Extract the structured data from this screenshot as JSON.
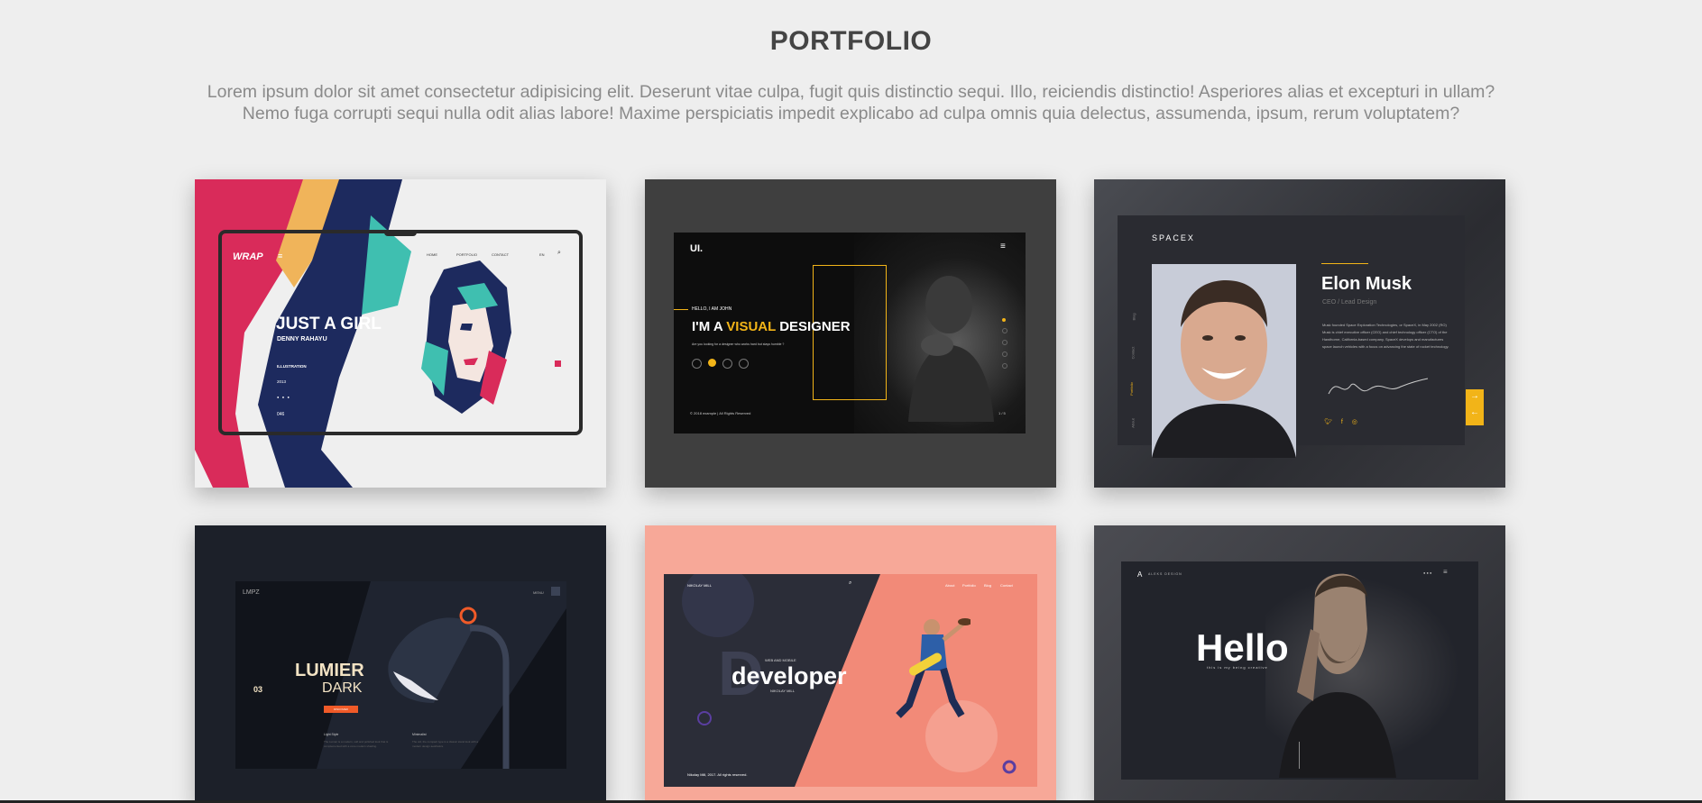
{
  "section": {
    "title": "PORTFOLIO",
    "intro_line1": "Lorem ipsum dolor sit amet consectetur adipisicing elit. Deserunt vitae culpa, fugit quis distinctio sequi. Illo, reiciendis distinctio! Asperiores alias et excepturi in ullam?",
    "intro_line2": "Nemo fuga corrupti sequi nulla odit alias labore! Maxime perspiciatis impedit explicabo ad culpa omnis quia delectus, assumenda, ipsum, rerum voluptatem?"
  },
  "colors": {
    "page_bg": "#eeeeee",
    "title": "#444444",
    "intro_text": "#8a8a8a",
    "accent_yellow": "#f2b418",
    "accent_pink": "#d92b5a",
    "accent_orange": "#f05a28",
    "accent_salmon": "#f7a898"
  },
  "portfolio": [
    {
      "id": "girl",
      "nav": [
        "HOME",
        "PORTFOLIO",
        "CONTACT",
        "EN"
      ],
      "headline": "JUST A GIRL",
      "subtitle": "DENNY RAHAYU",
      "category": "ILLUSTRATION",
      "year": "2013",
      "count": "046"
    },
    {
      "id": "visual-designer",
      "logo": "UI.",
      "kicker": "HELLO, I AM JOHN",
      "headline_pre": "I'M A ",
      "headline_accent": "VISUAL",
      "headline_post": " DESIGNER",
      "tagline": "Are you looking for a designer who works hard but stays humble ?",
      "footer": "© 2018 example | All Rights Reserved",
      "pager": "1 / 5"
    },
    {
      "id": "elon",
      "logo": "SPACEX",
      "name": "Elon Musk",
      "role": "CEO / Lead Design",
      "bio": "Musk founded Space Exploration Technologies, or SpaceX, in May 2002 (RO) Musk is chief executive officer (CEO) and chief technology officer (CTO) of the Hawthorne, California-based company. SpaceX develops and manufactures space launch vehicles with a focus on advancing the state of rocket technology.",
      "side_nav": [
        "Blog",
        "Contact",
        "Portfolio",
        "About"
      ]
    },
    {
      "id": "lumier",
      "logo": "LMPZ",
      "menu": "MENU",
      "headline": "LUMIER",
      "subheadline": "DARK",
      "index": "03",
      "button": "DISCOVER",
      "col1_title": "Light Style",
      "col1_text": "The Lumier is a modern, soft and polished look that is complemented with a cone modern shading.",
      "col2_title": "Minimalist",
      "col2_text": "The old, the compact type is a classic stand look with a modern design aesthetics."
    },
    {
      "id": "developer",
      "brand": "NIKOLAY MILL",
      "nav": [
        "About",
        "Portfolio",
        "Blog",
        "Contact"
      ],
      "kicker": "WEB AND MOBILE",
      "headline": "developer",
      "name": "NIKOLAY MILL",
      "footer": "Nikolay Mill, 2017. All rights reserved."
    },
    {
      "id": "hello",
      "brand": "ALEKS DESIGN",
      "headline": "Hello",
      "tagline": "this is my being creative"
    }
  ]
}
